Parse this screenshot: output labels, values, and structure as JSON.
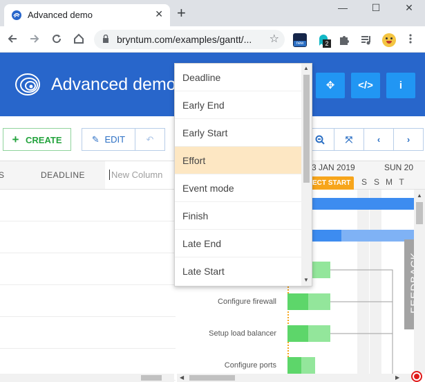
{
  "browser": {
    "tab_title": "Advanced demo",
    "tab_close": "✕",
    "new_tab": "+",
    "url": "bryntum.com/examples/gantt/...",
    "window_minimize": "—",
    "window_maximize": "☐",
    "window_close": "✕",
    "extension_badge": "2"
  },
  "app": {
    "title": "Advanced demo",
    "header_buttons": [
      "move-icon",
      "code-icon",
      "info-icon"
    ]
  },
  "toolbar": {
    "create_label": "CREATE",
    "edit_label": "EDIT"
  },
  "grid": {
    "headers": [
      "S",
      "DEADLINE"
    ],
    "new_column_placeholder": "New Column"
  },
  "gantt": {
    "week_label": "3 JAN 2019",
    "week_label_2": "SUN 20",
    "days": [
      "S",
      "S",
      "M",
      "T"
    ],
    "project_start": "ECT START",
    "tasks": [
      "Configure firewall",
      "Setup load balancer",
      "Configure ports"
    ],
    "colors": {
      "summary_bar": "#3d8cf0",
      "summary_bar_light": "#7fb2f5",
      "task_done": "#5dd66a",
      "task_todo": "#93e69b",
      "header": "#2866cb",
      "accent_orange": "#f7a51b"
    }
  },
  "dropdown": {
    "items": [
      "Deadline",
      "Early End",
      "Early Start",
      "Effort",
      "Event mode",
      "Finish",
      "Late End",
      "Late Start"
    ],
    "active_index": 3
  },
  "feedback_label": "FEEDBACK"
}
